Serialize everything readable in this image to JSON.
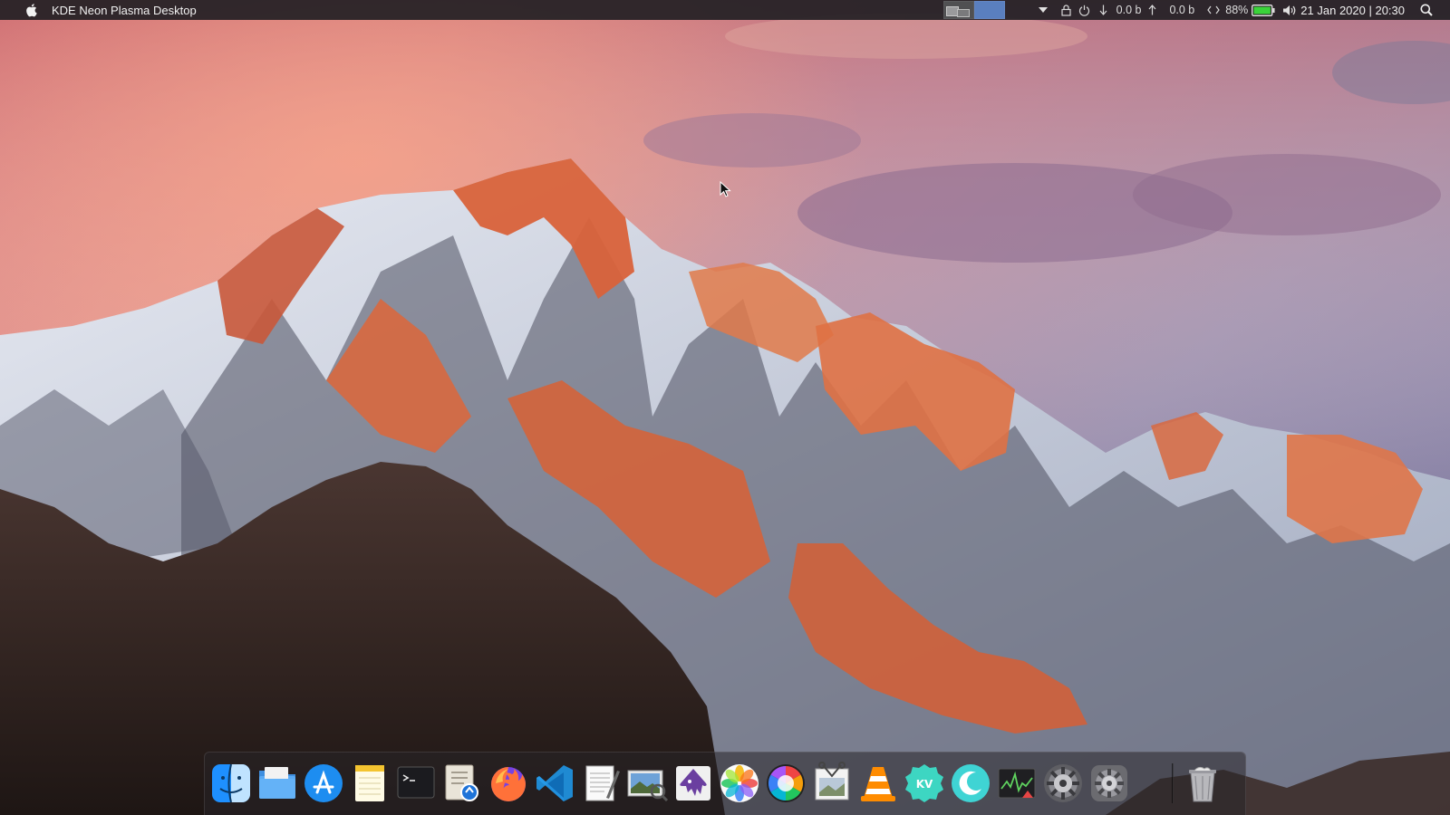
{
  "topbar": {
    "title": "KDE Neon Plasma Desktop",
    "apple_icon": "apple-logo-icon",
    "pager": {
      "desktops": 2,
      "active": 2
    },
    "tray": {
      "download_rate": "0.0 b",
      "upload_rate": "0.0 b",
      "battery_percent": "88%",
      "battery_level": 0.88,
      "datetime": "21 Jan 2020 | 20:30",
      "icons": [
        "tray-expander-icon",
        "lock-icon",
        "power-icon",
        "download-arrow-icon",
        "upload-arrow-icon",
        "network-icon",
        "battery-icon",
        "volume-icon",
        "search-icon"
      ]
    }
  },
  "dock": {
    "items": [
      {
        "name": "finder",
        "icon": "finder-icon",
        "running": true
      },
      {
        "name": "files",
        "icon": "folder-icon",
        "running": false
      },
      {
        "name": "app-store",
        "icon": "app-store-icon",
        "running": false
      },
      {
        "name": "notes",
        "icon": "notes-icon",
        "running": false
      },
      {
        "name": "terminal",
        "icon": "terminal-icon",
        "running": true
      },
      {
        "name": "preview",
        "icon": "preview-icon",
        "running": false
      },
      {
        "name": "firefox",
        "icon": "firefox-icon",
        "running": true
      },
      {
        "name": "vscode",
        "icon": "vscode-icon",
        "running": true
      },
      {
        "name": "text-editor",
        "icon": "text-editor-icon",
        "running": false
      },
      {
        "name": "image-viewer",
        "icon": "image-viewer-icon",
        "running": false
      },
      {
        "name": "inkscape",
        "icon": "inkscape-icon",
        "running": false
      },
      {
        "name": "photos",
        "icon": "photos-icon",
        "running": true
      },
      {
        "name": "color-picker",
        "icon": "color-wheel-icon",
        "running": true
      },
      {
        "name": "screenshot",
        "icon": "screenshot-icon",
        "running": false
      },
      {
        "name": "vlc",
        "icon": "vlc-icon",
        "running": false
      },
      {
        "name": "kdeconnect",
        "icon": "kdeconnect-icon",
        "running": false
      },
      {
        "name": "night-color",
        "icon": "moon-icon",
        "running": true
      },
      {
        "name": "system-monitor",
        "icon": "activity-monitor-icon",
        "running": false
      },
      {
        "name": "settings",
        "icon": "settings-gear-icon",
        "running": false
      },
      {
        "name": "system-preferences",
        "icon": "system-preferences-icon",
        "running": true
      },
      {
        "name": "trash",
        "icon": "trash-icon",
        "running": false
      }
    ]
  },
  "colors": {
    "panel": "#222024",
    "accent": "#5a7fbf",
    "battery": "#3ad33a",
    "running_dot": "#7fb3ff"
  }
}
